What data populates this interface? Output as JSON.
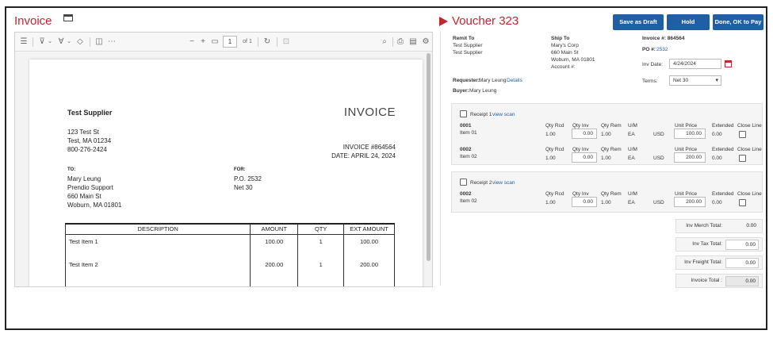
{
  "left": {
    "title": "Invoice",
    "toolbar": {
      "page_num": "1",
      "page_of": "of 1"
    }
  },
  "invoice": {
    "supplier_name": "Test Supplier",
    "supplier_address": [
      "123 Test St",
      "Test, MA 01234",
      "800-276-2424"
    ],
    "heading": "INVOICE",
    "number_line": "INVOICE #864564",
    "date_line": "DATE: APRIL 24, 2024",
    "to_label": "TO:",
    "to_lines": [
      "Mary Leung",
      "Prendio Support",
      "660 Main St",
      "Woburn, MA 01801"
    ],
    "for_label": "FOR:",
    "for_lines": [
      "P.O. 2532",
      "Net 30"
    ],
    "table": {
      "headers": [
        "DESCRIPTION",
        "AMOUNT",
        "QTY",
        "EXT AMOUNT"
      ],
      "rows": [
        [
          "Test Item 1",
          "100.00",
          "1",
          "100.00"
        ],
        [
          "Test Item 2",
          "200.00",
          "1",
          "200.00"
        ]
      ]
    }
  },
  "voucher": {
    "title": "Voucher 323",
    "buttons": {
      "save_draft": "Save as Draft",
      "hold": "Hold",
      "done": "Done, OK to Pay"
    },
    "remit_to": {
      "label": "Remit To",
      "lines": [
        "Test Supplier",
        "Test Supplier"
      ]
    },
    "ship_to": {
      "label": "Ship To",
      "lines": [
        "Mary's Corp",
        "660 Main St",
        "Woburn, MA 01801",
        "Account #:"
      ]
    },
    "invoice_label": "Invoice #: 864564",
    "po_label": "PO #:",
    "po_value": "2532",
    "inv_date_label": "Inv Date:",
    "inv_date_value": "4/24/2024",
    "terms_label": "Terms:",
    "terms_value": "Net 30",
    "requester_label": "Requester:",
    "requester_value": "Mary Leung",
    "details_link": "Details",
    "buyer_label": "Buyer:",
    "buyer_value": "Mary Leung",
    "col_headers": {
      "qty_rcd": "Qty Rcd",
      "qty_inv": "Qty Inv",
      "qty_rem": "Qty Rem",
      "uom": "U/M",
      "unit_price": "Unit Price",
      "extended": "Extended",
      "close_line": "Close Line"
    },
    "receipts": [
      {
        "label": "Receipt 1",
        "view": "view scan",
        "lines": [
          {
            "code": "0001",
            "item": "Item 01",
            "qty_rcd": "1.00",
            "qty_inv": "0.00",
            "qty_rem": "1.00",
            "uom": "EA",
            "currency": "USD",
            "unit_price": "100.00",
            "extended": "0.00"
          },
          {
            "code": "0002",
            "item": "Item 02",
            "qty_rcd": "1.00",
            "qty_inv": "0.00",
            "qty_rem": "1.00",
            "uom": "EA",
            "currency": "USD",
            "unit_price": "200.00",
            "extended": "0.00"
          }
        ]
      },
      {
        "label": "Receipt 2",
        "view": "view scan",
        "lines": [
          {
            "code": "0002",
            "item": "Item 02",
            "qty_rcd": "1.00",
            "qty_inv": "0.00",
            "qty_rem": "1.00",
            "uom": "EA",
            "currency": "USD",
            "unit_price": "200.00",
            "extended": "0.00"
          }
        ]
      }
    ],
    "totals": [
      {
        "label": "Inv Merch Total:",
        "value": "0.00"
      },
      {
        "label": "Inv Tax Total:",
        "value": "0.00"
      },
      {
        "label": "Inv Freight Total:",
        "value": "0.00"
      },
      {
        "label": "Invoice Total :",
        "value": "0.00"
      }
    ]
  }
}
